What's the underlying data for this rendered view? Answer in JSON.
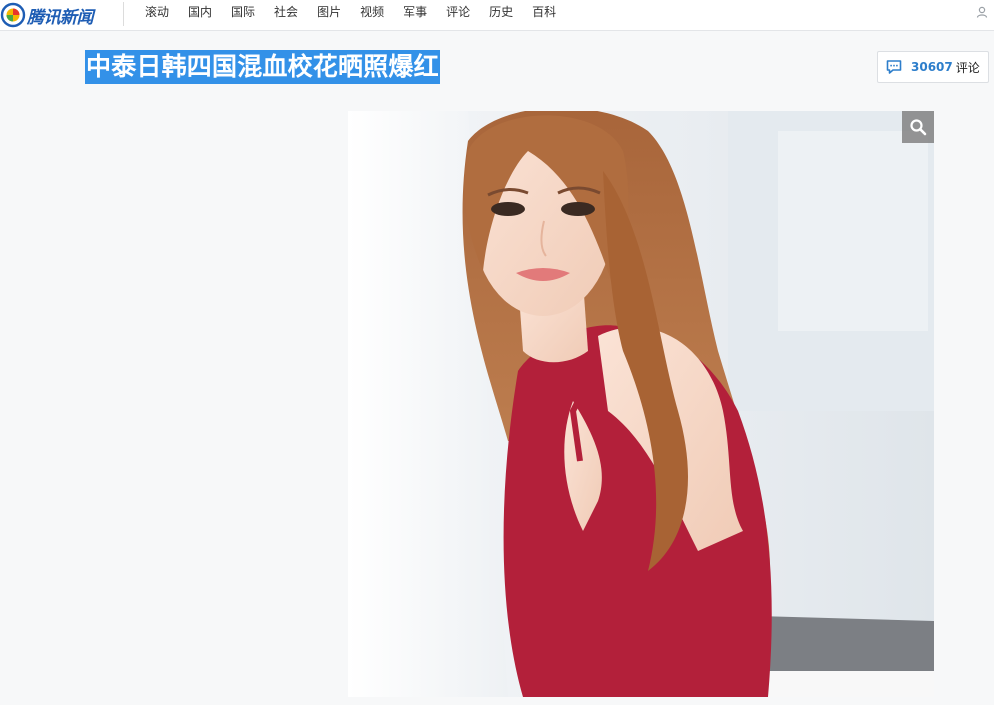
{
  "site": {
    "logo_text": "腾讯新闻",
    "logo_icon": "tencent-news-logo-icon"
  },
  "nav": {
    "items": [
      {
        "label": "滚动"
      },
      {
        "label": "国内"
      },
      {
        "label": "国际"
      },
      {
        "label": "社会"
      },
      {
        "label": "图片"
      },
      {
        "label": "视频"
      },
      {
        "label": "军事"
      },
      {
        "label": "评论"
      },
      {
        "label": "历史"
      },
      {
        "label": "百科"
      }
    ]
  },
  "article": {
    "title": "中泰日韩四国混血校花晒照爆红",
    "title_highlight_color": "#3391e8"
  },
  "comments": {
    "count": "30607",
    "label": "评论",
    "icon": "comment-bubble-icon"
  },
  "photo": {
    "zoom_icon": "search-icon"
  },
  "colors": {
    "accent": "#2d7ecb",
    "page_bg": "#f7f8f9"
  }
}
